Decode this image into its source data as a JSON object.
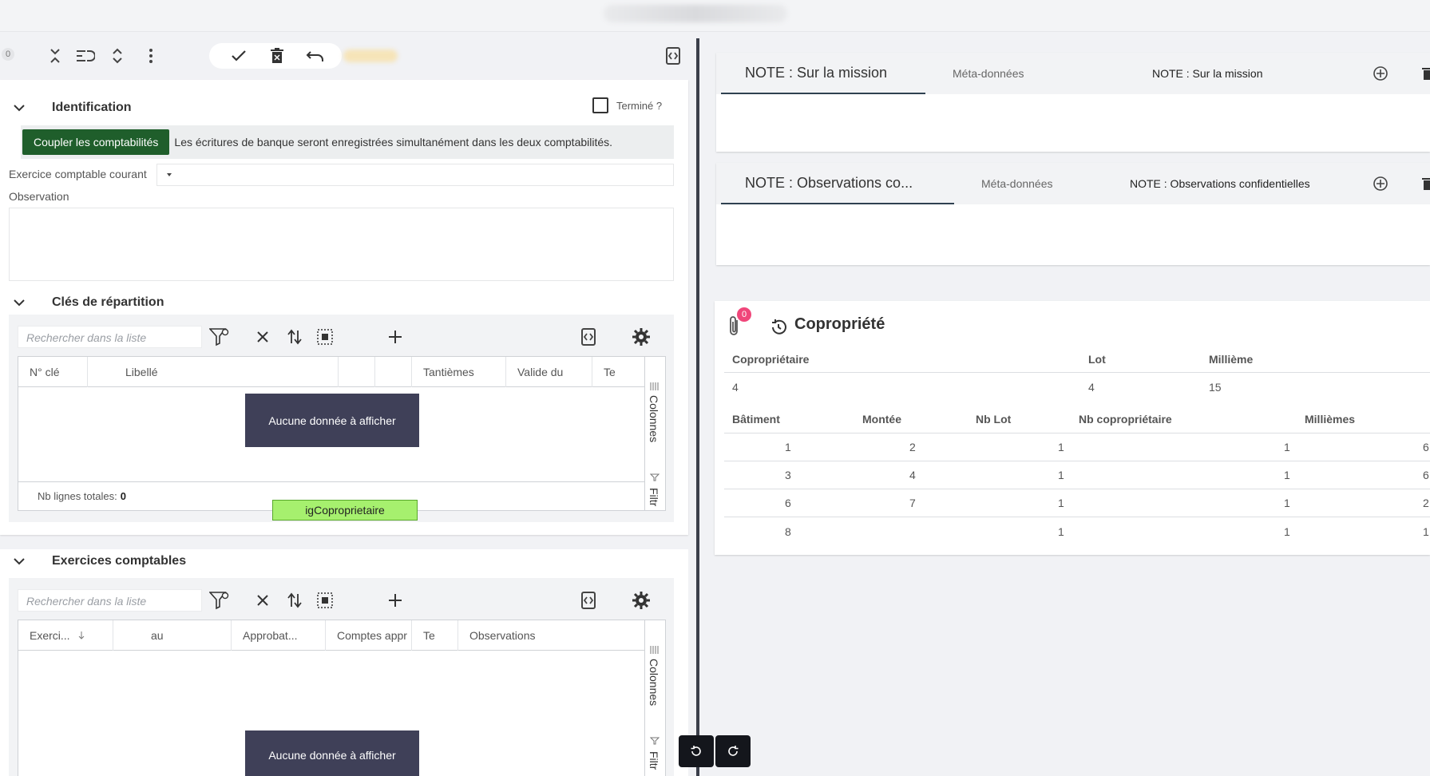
{
  "toolbar": {
    "attachments_count": "0",
    "icons": [
      "collapse-all-icon",
      "wrap-icon",
      "expand-icon",
      "more-vert-icon",
      "check-icon",
      "delete-icon",
      "undo-icon",
      "code-toggle-icon"
    ]
  },
  "identification": {
    "title": "Identification",
    "termine_label": "Terminé ?",
    "couple_button": "Coupler les comptabilités",
    "couple_info": "Les écritures de banque seront enregistrées simultanément dans les deux comptabilités.",
    "exercice_label": "Exercice comptable courant",
    "exercice_value": "",
    "observation_label": "Observation"
  },
  "cles": {
    "title": "Clés de répartition",
    "search_placeholder": "Rechercher dans la liste",
    "columns": [
      "N° clé",
      "Libellé",
      "",
      "",
      "Tantièmes",
      "Valide du",
      "Te"
    ],
    "no_data": "Aucune donnée à afficher",
    "side_colonnes": "Colonnes",
    "side_filtres": "Filtr",
    "footer_label": "Nb lignes totales:",
    "footer_count": "0",
    "tag": "igCoproprietaire"
  },
  "exercices": {
    "title": "Exercices comptables",
    "search_placeholder": "Rechercher dans la liste",
    "columns": [
      "Exerci...",
      "au",
      "Approbat...",
      "Comptes appr",
      "Te",
      "Observations"
    ],
    "no_data": "Aucune donnée à afficher",
    "side_colonnes": "Colonnes",
    "side_filtres": "Filtr"
  },
  "note1": {
    "tab_active": "NOTE : Sur la mission",
    "tab_meta": "Méta-données",
    "tab_title": "NOTE : Sur la mission"
  },
  "note2": {
    "tab_active": "NOTE : Observations co...",
    "tab_meta": "Méta-données",
    "tab_title": "NOTE : Observations confidentielles"
  },
  "copropriete": {
    "title": "Copropriété",
    "attachments_count": "0",
    "summary_headers": [
      "Copropriétaire",
      "Lot",
      "Millième"
    ],
    "summary_values": [
      "4",
      "4",
      "15"
    ],
    "table_headers": [
      "Bâtiment",
      "Montée",
      "Nb Lot",
      "Nb copropriétaire",
      "Millièmes"
    ],
    "rows": [
      {
        "batiment": "1",
        "montee": "2",
        "nblot": "1",
        "nbcopro": "1",
        "milliemes": "6"
      },
      {
        "batiment": "3",
        "montee": "4",
        "nblot": "1",
        "nbcopro": "1",
        "milliemes": "6"
      },
      {
        "batiment": "6",
        "montee": "7",
        "nblot": "1",
        "nbcopro": "1",
        "milliemes": "2"
      },
      {
        "batiment": "8",
        "montee": "",
        "nblot": "1",
        "nbcopro": "1",
        "milliemes": "1"
      }
    ]
  }
}
